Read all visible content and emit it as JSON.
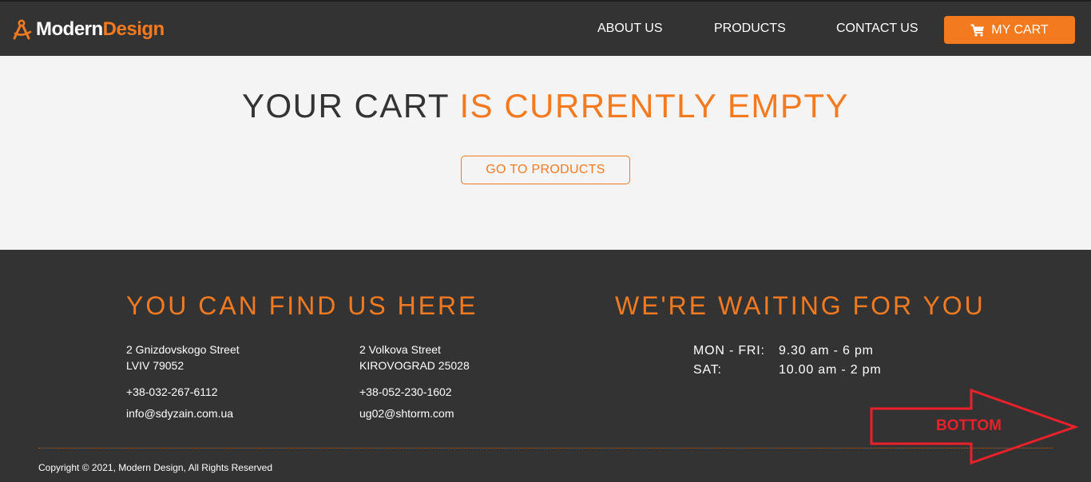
{
  "header": {
    "logo": {
      "word1": "Modern",
      "word2": "Design"
    },
    "nav": {
      "about": "ABOUT US",
      "products": "PRODUCTS",
      "contact": "CONTACT US"
    },
    "cart_button": "MY CART",
    "icons": {
      "logo": "drafting-compass-icon",
      "cart": "shopping-cart-icon"
    }
  },
  "main": {
    "headline_dark": "YOUR CART ",
    "headline_accent": "IS CURRENTLY EMPTY",
    "go_button": "GO TO PRODUCTS"
  },
  "footer": {
    "find_title": "YOU CAN FIND US HERE",
    "wait_title": "WE'RE WAITING FOR YOU",
    "addresses": [
      {
        "street": "2 Gnizdovskogo Street",
        "city": "LVIV 79052",
        "phone": "+38-032-267-6112",
        "email": "info@sdyzain.com.ua"
      },
      {
        "street": "2 Volkova Street",
        "city": "KIROVOGRAD 25028",
        "phone": "+38-052-230-1602",
        "email": "ug02@shtorm.com"
      }
    ],
    "hours": [
      {
        "days": "MON - FRI:",
        "time": "9.30 am - 6 pm"
      },
      {
        "days": "SAT:",
        "time": "10.00 am - 2 pm"
      }
    ],
    "copyright": "Copyright © 2021, Modern Design, All Rights Reserved"
  },
  "annotation": {
    "label": "BOTTOM",
    "icon": "right-arrow-icon"
  },
  "colors": {
    "accent": "#f47a20",
    "dark": "#333333",
    "light": "#f4f4f4",
    "annotation": "#e8212a"
  }
}
